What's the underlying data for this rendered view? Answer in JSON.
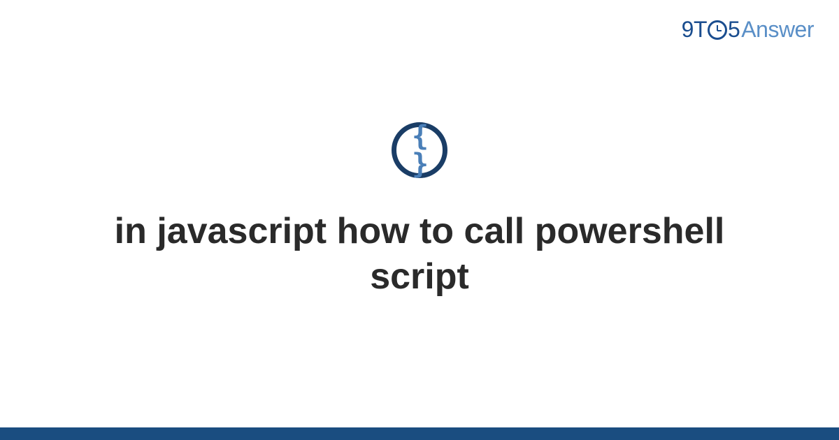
{
  "logo": {
    "part1": "9T",
    "part2": "5",
    "part3": "Answer"
  },
  "icon": {
    "glyph": "{ }"
  },
  "title": "in javascript how to call powershell script"
}
